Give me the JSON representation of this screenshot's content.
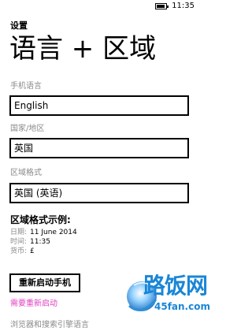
{
  "status_bar": {
    "time": "11:35"
  },
  "header": {
    "app_title": "设置",
    "page_title": "语言 + 区域"
  },
  "phone_language": {
    "label": "手机语言",
    "value": "English"
  },
  "country_region": {
    "label": "国家/地区",
    "value": "英国"
  },
  "regional_format": {
    "label": "区域格式",
    "value": "英国 (英语)"
  },
  "format_example": {
    "title": "区域格式示例:",
    "rows": [
      {
        "key": "日期:",
        "value": "11 June 2014"
      },
      {
        "key": "时间:",
        "value": "11:35"
      },
      {
        "key": "货币:",
        "value": "£"
      }
    ]
  },
  "restart": {
    "button_label": "重新启动手机",
    "note": "需要重新启动"
  },
  "browser_section": {
    "label": "浏览器和搜索引擎语言"
  },
  "watermark": {
    "title": "路饭网",
    "domain": "45fan.com"
  },
  "colors": {
    "accent_note": "#e040c0",
    "label_gray": "#8a8a8a",
    "watermark_blue": "#1a86d6"
  }
}
